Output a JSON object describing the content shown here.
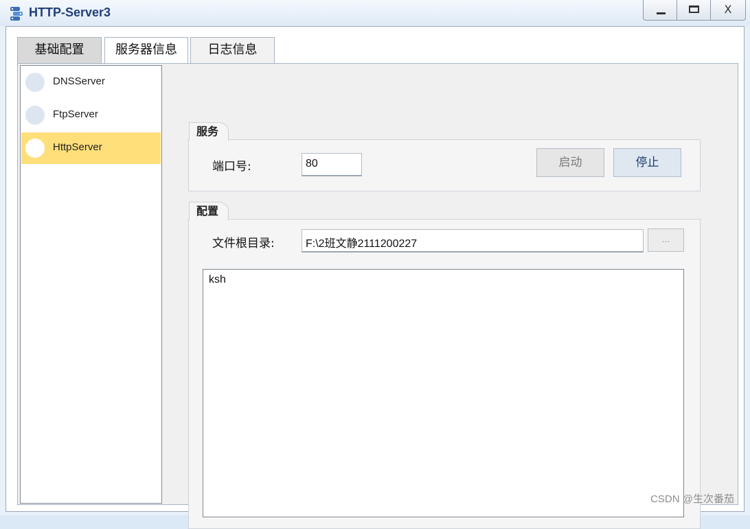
{
  "window": {
    "title": "HTTP-Server3",
    "controls": {
      "minimize_icon": "minimize-icon",
      "maximize_icon": "maximize-icon",
      "close_label": "X"
    }
  },
  "tabs": [
    {
      "label": "基础配置"
    },
    {
      "label": "服务器信息"
    },
    {
      "label": "日志信息"
    }
  ],
  "sidebar": {
    "items": [
      {
        "label": "DNSServer",
        "selected": false
      },
      {
        "label": "FtpServer",
        "selected": false
      },
      {
        "label": "HttpServer",
        "selected": true
      }
    ]
  },
  "service": {
    "group_label": "服务",
    "port_label": "端口号:",
    "port_value": "80",
    "start_label": "启动",
    "stop_label": "停止"
  },
  "config": {
    "group_label": "配置",
    "root_label": "文件根目录:",
    "root_value": "F:\\2班文静2111200227",
    "browse_label": "...",
    "content_text": "ksh"
  },
  "watermark": "CSDN @生次番茄",
  "colors": {
    "selected_item": "#ffdf7a",
    "title_text": "#1f3f78"
  }
}
